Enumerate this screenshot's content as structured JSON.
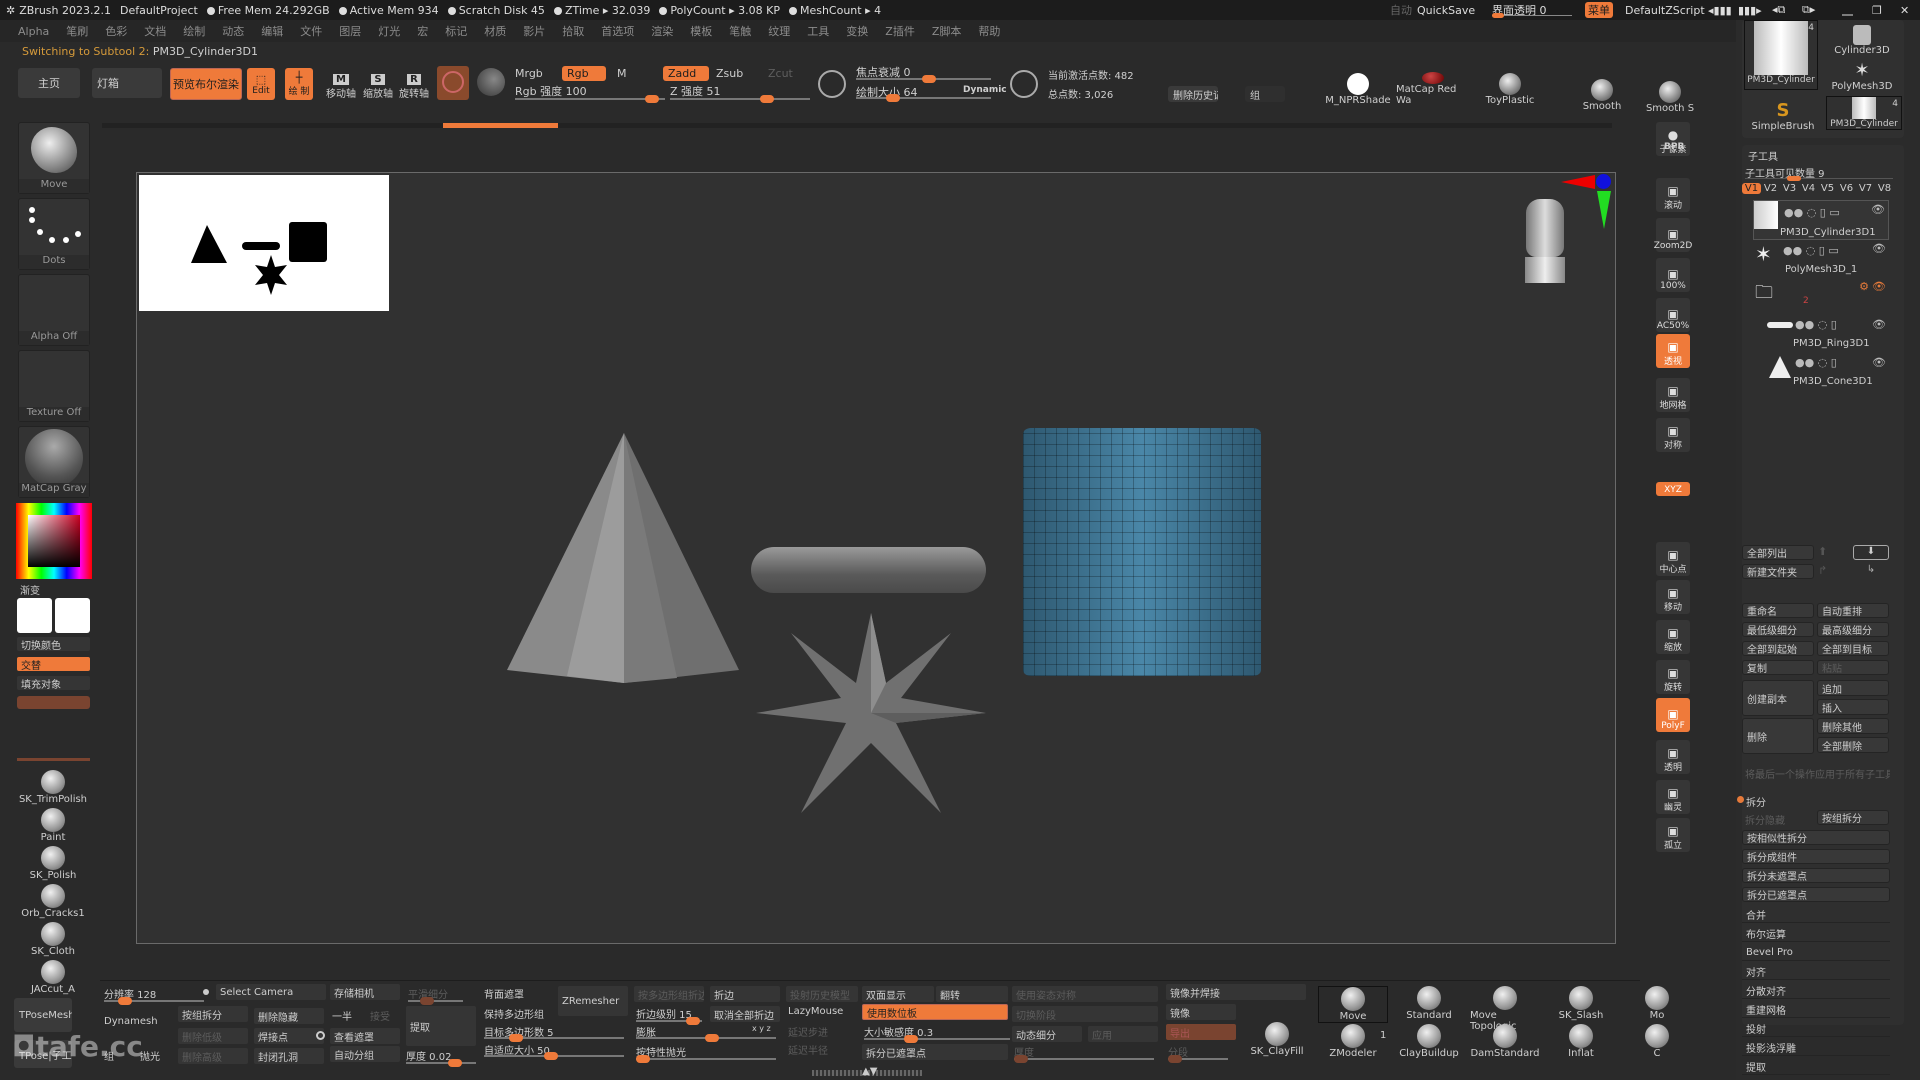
{
  "titlebar": {
    "app": "ZBrush 2023.2.1",
    "project": "DefaultProject",
    "stats": [
      "Free Mem 24.292GB",
      "Active Mem 934",
      "Scratch Disk 45",
      "ZTime ▸ 32.039",
      "PolyCount ▸ 3.08 KP",
      "MeshCount ▸ 4"
    ],
    "auto_label": "自动",
    "quicksave": "QuickSave",
    "ui_transparency": "界面透明 0",
    "menu_btn": "菜单",
    "zscript": "DefaultZScript"
  },
  "menubar": [
    "Alpha",
    "笔刷",
    "色彩",
    "文档",
    "绘制",
    "动态",
    "编辑",
    "文件",
    "图层",
    "灯光",
    "宏",
    "标记",
    "材质",
    "影片",
    "拾取",
    "首选项",
    "渲染",
    "模板",
    "笔触",
    "纹理",
    "工具",
    "变换",
    "Z插件",
    "Z脚本",
    "帮助"
  ],
  "status": {
    "prefix": "Switching to Subtool 2:",
    "name": "PM3D_Cylinder3D1"
  },
  "toolbar": {
    "home": "主页",
    "lightbox": "灯箱",
    "bool_preview": "预览布尔渲染",
    "edit": "Edit",
    "draw": "绘 制",
    "move_axis": "移动轴",
    "scale_axis": "缩放轴",
    "rotate_axis": "旋转轴",
    "mrgb": "Mrgb",
    "rgb": "Rgb",
    "m": "M",
    "rgb_intensity": "Rgb 强度 100",
    "zadd": "Zadd",
    "zsub": "Zsub",
    "zcut": "Zcut",
    "z_intensity": "Z 强度 51",
    "focal_shift": "焦点衰减 0",
    "draw_size": "绘制大小 64",
    "dynamic": "Dynamic",
    "active_points": "当前激活点数: 482",
    "total_points": "总点数: 3,026",
    "delete_history": "删除历史记录",
    "group": "组",
    "materials": [
      "M_NPRShade",
      "MatCap Red Wa",
      "ToyPlastic"
    ],
    "smooth": [
      "Smooth",
      "Smooth S"
    ]
  },
  "left_panel": {
    "brush": "Move",
    "stroke": "Dots",
    "alpha": "Alpha Off",
    "texture": "Texture Off",
    "material": "MatCap Gray",
    "gradient": "渐变",
    "switch_color": "切换颜色",
    "alternate": "交替",
    "fill_object": "填充对象",
    "brushes": [
      "SK_TrimPolish",
      "Paint",
      "SK_Polish",
      "Orb_Cracks1",
      "SK_Cloth",
      "JACcut_A"
    ],
    "tpose_mesh": "TPoseMesh",
    "tpose_subtool": "TPose|子工具"
  },
  "right_shelf": [
    "子像素",
    "滚动",
    "Zoom2D",
    "100%",
    "AC50%",
    "透视",
    "地网格",
    "对称",
    "中心点",
    "移动",
    "缩放",
    "旋转",
    "PolyF",
    "透明",
    "幽灵",
    "孤立"
  ],
  "right_shelf_labels": {
    "bpr": "BPR",
    "xyz": "XYZ",
    "dynamic": "Dynamic"
  },
  "tool_panel": {
    "thumbs": [
      "PM3D_Cylinder",
      "Cylinder3D",
      "PolyMesh3D",
      "SimpleBrush",
      "PM3D_Cylinder"
    ],
    "thumb_count": "4",
    "subtool_title": "子工具",
    "visible_count": "子工具可见数量 9",
    "versions": [
      "V1",
      "V2",
      "V3",
      "V4",
      "V5",
      "V6",
      "V7",
      "V8"
    ],
    "subtools": [
      "PM3D_Cylinder3D1",
      "PolyMesh3D_1",
      "PM3D_Ring3D1",
      "PM3D_Cone3D1"
    ],
    "folder_count": "2",
    "list_all": "全部列出",
    "new_folder": "新建文件夹",
    "actions": [
      [
        "重命名",
        "自动重排"
      ],
      [
        "最低级细分",
        "最高级细分"
      ],
      [
        "全部到起始",
        "全部到目标"
      ],
      [
        "复制",
        "粘贴"
      ]
    ],
    "duplicate": "创建副本",
    "append": "追加",
    "insert": "插入",
    "delete": "删除",
    "delete_other": "删除其他",
    "delete_all": "全部删除",
    "apply_all_hint": "将最后一个操作应用于所有子工具",
    "split_title": "拆分",
    "split_hidden": "拆分隐藏",
    "group_split": "按组拆分",
    "split_items": [
      "按相似性拆分",
      "拆分成组件",
      "拆分未遮罩点",
      "拆分已遮罩点"
    ],
    "sections": [
      "合并",
      "布尔运算",
      "Bevel Pro",
      "对齐",
      "分散对齐",
      "重建网格",
      "投射",
      "投影浅浮雕",
      "提取"
    ]
  },
  "bottom": {
    "resolution": "分辨率 128",
    "select_camera": "Select Camera",
    "store_camera": "存储相机",
    "flat_subdiv": "平滑细分",
    "dynamesh": "Dynamesh",
    "group_split": "按组拆分",
    "del_hidden": "删除隐藏",
    "half": "一半",
    "accept": "接受",
    "extract": "提取",
    "del_lower": "删除低级",
    "weld": "焊接点",
    "view_mask": "查看遮罩",
    "thickness": "厚度 0.02",
    "group": "组",
    "polish": "抛光",
    "del_higher": "删除高级",
    "close_holes": "封闭孔洞",
    "auto_group": "自动分组",
    "backface_mask": "背面遮罩",
    "keep_groups": "保持多边形组",
    "target_poly": "目标多边形数 5",
    "adaptive_size": "自适应大小 50",
    "zremesher": "ZRemesher",
    "crease_pg": "按多边形组折边",
    "crease": "折边",
    "crease_level": "折边级别 15",
    "uncrease_all": "取消全部折边",
    "inflate": "膨胀",
    "xyz": "x y z",
    "polish_features": "按特性抛光",
    "project_history": "投射历史模型",
    "lazymouse": "LazyMouse",
    "lazy_step": "延迟步进",
    "lazy_radius": "延迟半径",
    "double": "双面显示",
    "flip": "翻转",
    "use_tablet": "使用数位板",
    "size_sensitivity": "大小敏感度 0.3",
    "split_masked": "拆分已遮罩点",
    "use_pose_sym": "使用姿态对称",
    "switch_stage": "切换阶段",
    "dynamic_subdiv": "动态细分",
    "apply": "应用",
    "thickness2": "厚度",
    "mirror_weld": "镜像并焊接",
    "mirror": "镜像",
    "export": "导出",
    "segments": "分段",
    "sk_clayfill": "SK_ClayFill",
    "brushes_row1": [
      "Move",
      "Standard",
      "Move Topologic",
      "SK_Slash",
      "Mo"
    ],
    "brushes_row2": [
      "ZModeler",
      "ClayBuildup",
      "DamStandard",
      "Inflat",
      "C"
    ],
    "zmodeler_count": "1"
  },
  "watermark": "tafe.cc",
  "colors": {
    "accent": "#ef7a3a",
    "bg": "#2a2a2a",
    "viewport": "#313131",
    "cylinder": "#3c6f8c"
  }
}
